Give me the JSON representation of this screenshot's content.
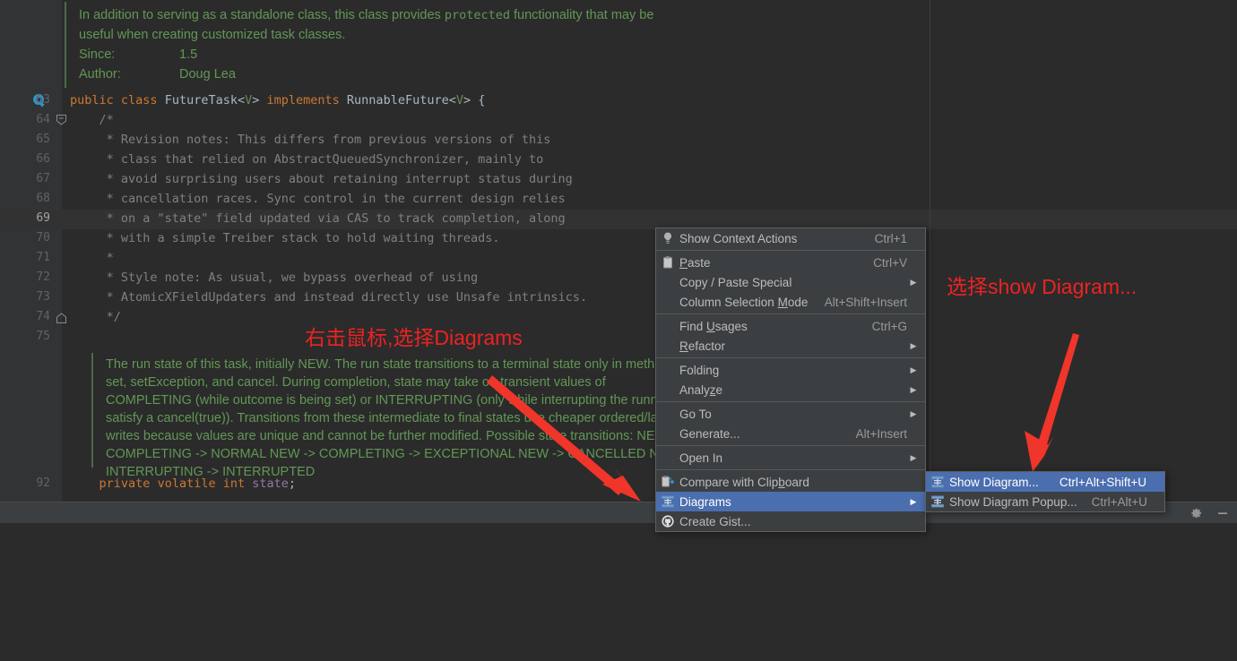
{
  "editor": {
    "javadoc_top": {
      "paragraph": "In addition to serving as a standalone class, this class provides protected functionality that may be useful when creating customized task classes.",
      "line1_a": "In addition to serving as a standalone class, this class provides ",
      "line1_b": "protected",
      "line1_c": " functionality that may be",
      "line2": "useful when creating customized task classes.",
      "since_label": "Since:",
      "since_value": "1.5",
      "author_label": "Author:",
      "author_value": "Doug Lea"
    },
    "line_numbers": [
      "63",
      "64",
      "65",
      "66",
      "67",
      "68",
      "69",
      "70",
      "71",
      "72",
      "73",
      "74",
      "75"
    ],
    "current_line_number": "69",
    "bottom_line_number": "92",
    "code_lines": [
      {
        "n": "63",
        "segments": [
          {
            "t": "public",
            "c": "kw"
          },
          {
            "t": " ",
            "c": ""
          },
          {
            "t": "class",
            "c": "kw"
          },
          {
            "t": " FutureTask<",
            "c": "typ"
          },
          {
            "t": "V",
            "c": "gen"
          },
          {
            "t": "> ",
            "c": "typ"
          },
          {
            "t": "implements",
            "c": "kw"
          },
          {
            "t": " RunnableFuture<",
            "c": "typ"
          },
          {
            "t": "V",
            "c": "gen"
          },
          {
            "t": "> {",
            "c": "typ"
          }
        ]
      },
      {
        "n": "64",
        "segments": [
          {
            "t": "    /*",
            "c": "cmt"
          }
        ]
      },
      {
        "n": "65",
        "segments": [
          {
            "t": "     * Revision notes: This differs from previous versions of this",
            "c": "cmt"
          }
        ]
      },
      {
        "n": "66",
        "segments": [
          {
            "t": "     * class that relied on AbstractQueuedSynchronizer, mainly to",
            "c": "cmt"
          }
        ]
      },
      {
        "n": "67",
        "segments": [
          {
            "t": "     * avoid surprising users about retaining interrupt status during",
            "c": "cmt"
          }
        ]
      },
      {
        "n": "68",
        "segments": [
          {
            "t": "     * cancellation races. Sync control in the current design relies",
            "c": "cmt"
          }
        ]
      },
      {
        "n": "69",
        "segments": [
          {
            "t": "     * on a \"state\" field updated via CAS to track completion, along",
            "c": "cmt"
          }
        ]
      },
      {
        "n": "70",
        "segments": [
          {
            "t": "     * with a simple Treiber stack to hold waiting threads.",
            "c": "cmt"
          }
        ]
      },
      {
        "n": "71",
        "segments": [
          {
            "t": "     *",
            "c": "cmt"
          }
        ]
      },
      {
        "n": "72",
        "segments": [
          {
            "t": "     * Style note: As usual, we bypass overhead of using",
            "c": "cmt"
          }
        ]
      },
      {
        "n": "73",
        "segments": [
          {
            "t": "     * AtomicXFieldUpdaters and instead directly use Unsafe intrinsics.",
            "c": "cmt"
          }
        ]
      },
      {
        "n": "74",
        "segments": [
          {
            "t": "     */",
            "c": "cmt"
          }
        ]
      },
      {
        "n": "75",
        "segments": [
          {
            "t": "",
            "c": "cmt"
          }
        ]
      }
    ],
    "javadoc_state": {
      "lines": [
        "The run state of this task, initially NEW. The run state transitions to a terminal state only in methods",
        "set, setException, and cancel. During completion, state may take on transient values of",
        "COMPLETING (while outcome is being set) or INTERRUPTING (only while interrupting the runner to",
        "satisfy a cancel(true)). Transitions from these intermediate to final states use cheaper ordered/lazy",
        "writes because values are unique and cannot be further modified. Possible state transitions: NEW ->",
        "COMPLETING -> NORMAL NEW -> COMPLETING -> EXCEPTIONAL NEW -> CANCELLED NEW ->",
        "INTERRUPTING -> INTERRUPTED"
      ]
    },
    "field_line": {
      "segments": [
        {
          "t": "    ",
          "c": ""
        },
        {
          "t": "private",
          "c": "kw"
        },
        {
          "t": " ",
          "c": ""
        },
        {
          "t": "volatile",
          "c": "kw"
        },
        {
          "t": " ",
          "c": ""
        },
        {
          "t": "int",
          "c": "kw"
        },
        {
          "t": " ",
          "c": ""
        },
        {
          "t": "state",
          "c": "fld"
        },
        {
          "t": ";",
          "c": "typ"
        }
      ]
    }
  },
  "context_menu": {
    "items": [
      {
        "icon": "lightbulb-icon",
        "label": "Show Context Actions",
        "mnemonic": "",
        "accel": "Ctrl+1",
        "arrow": false,
        "selected": false,
        "sep_after": true
      },
      {
        "icon": "clipboard-icon",
        "label": "Paste",
        "mnemonic": "P",
        "accel": "Ctrl+V",
        "arrow": false,
        "selected": false,
        "sep_after": false
      },
      {
        "icon": "",
        "label": "Copy / Paste Special",
        "mnemonic": "",
        "accel": "",
        "arrow": true,
        "selected": false,
        "sep_after": false
      },
      {
        "icon": "",
        "label": "Column Selection Mode",
        "mnemonic": "M",
        "accel": "Alt+Shift+Insert",
        "arrow": false,
        "selected": false,
        "sep_after": true
      },
      {
        "icon": "",
        "label": "Find Usages",
        "mnemonic": "U",
        "accel": "Ctrl+G",
        "arrow": false,
        "selected": false,
        "sep_after": false
      },
      {
        "icon": "",
        "label": "Refactor",
        "mnemonic": "R",
        "accel": "",
        "arrow": true,
        "selected": false,
        "sep_after": true
      },
      {
        "icon": "",
        "label": "Folding",
        "mnemonic": "",
        "accel": "",
        "arrow": true,
        "selected": false,
        "sep_after": false
      },
      {
        "icon": "",
        "label": "Analyze",
        "mnemonic": "z",
        "accel": "",
        "arrow": true,
        "selected": false,
        "sep_after": true
      },
      {
        "icon": "",
        "label": "Go To",
        "mnemonic": "",
        "accel": "",
        "arrow": true,
        "selected": false,
        "sep_after": false
      },
      {
        "icon": "",
        "label": "Generate...",
        "mnemonic": "",
        "accel": "Alt+Insert",
        "arrow": false,
        "selected": false,
        "sep_after": true
      },
      {
        "icon": "",
        "label": "Open In",
        "mnemonic": "",
        "accel": "",
        "arrow": true,
        "selected": false,
        "sep_after": true
      },
      {
        "icon": "compare-clipboard-icon",
        "label": "Compare with Clipboard",
        "mnemonic": "b",
        "accel": "",
        "arrow": false,
        "selected": false,
        "sep_after": false
      },
      {
        "icon": "diagram-icon",
        "label": "Diagrams",
        "mnemonic": "",
        "accel": "",
        "arrow": true,
        "selected": true,
        "sep_after": false
      },
      {
        "icon": "github-icon",
        "label": "Create Gist...",
        "mnemonic": "",
        "accel": "",
        "arrow": false,
        "selected": false,
        "sep_after": false
      }
    ]
  },
  "submenu": {
    "items": [
      {
        "icon": "diagram-icon",
        "label": "Show Diagram...",
        "accel": "Ctrl+Alt+Shift+U",
        "selected": true
      },
      {
        "icon": "diagram-icon",
        "label": "Show Diagram Popup...",
        "accel": "Ctrl+Alt+U",
        "selected": false
      }
    ]
  },
  "annotations": {
    "left_note": "右击鼠标,选择Diagrams",
    "right_note": "选择show Diagram...",
    "color": "#ee2222"
  },
  "statusbar": {
    "gear_icon": "gear-icon",
    "minimize_icon": "minimize-icon"
  },
  "colors": {
    "editor_bg": "#2b2b2b",
    "gutter_bg": "#313335",
    "menu_bg": "#3c3f41",
    "menu_selected": "#4b6eaf",
    "keyword": "#cc7832",
    "comment": "#808080",
    "javadoc": "#629755",
    "field": "#9876aa",
    "annotation_red": "#ee2222"
  }
}
